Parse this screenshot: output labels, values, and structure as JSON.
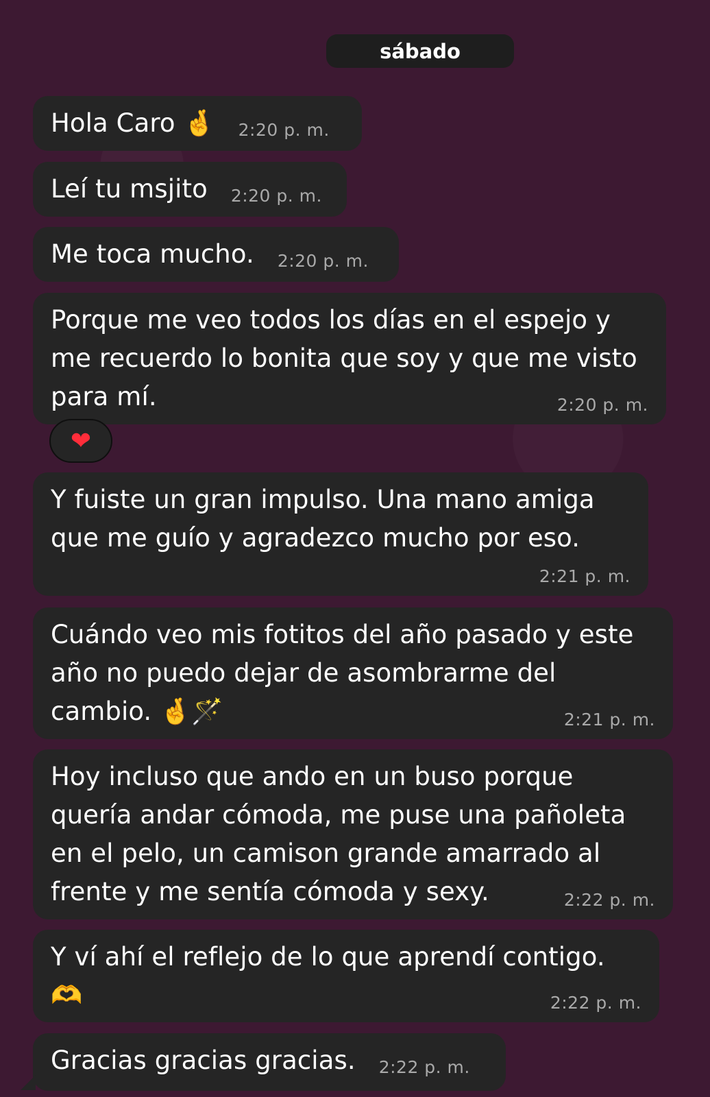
{
  "date_label": "sábado",
  "messages": [
    {
      "text": "Hola Caro 🤞",
      "time": "2:20 p. m."
    },
    {
      "text": "Leí tu msjito",
      "time": "2:20 p. m."
    },
    {
      "text": "Me toca mucho.",
      "time": "2:20 p. m."
    },
    {
      "text": "Porque me veo todos los días en el espejo y me recuerdo lo bonita que soy y que me visto para mí.",
      "time": "2:20 p. m.",
      "reaction": "❤"
    },
    {
      "text": "Y fuiste un gran impulso. Una mano amiga que me guío y agradezco mucho por eso.",
      "time": "2:21 p. m."
    },
    {
      "text": "Cuándo veo mis fotitos del año pasado y este año no puedo dejar de asombrarme del cambio. 🤞🪄",
      "time": "2:21 p. m."
    },
    {
      "text": "Hoy incluso que ando en un buso porque quería andar cómoda, me puse una pañoleta en el pelo, un camison grande amarrado al frente y me sentía cómoda y sexy.",
      "time": "2:22 p. m."
    },
    {
      "text": "Y ví ahí el reflejo de lo que aprendí contigo. 🫶",
      "time": "2:22 p. m."
    },
    {
      "text": "Gracias gracias gracias.",
      "time": "2:22 p. m."
    }
  ]
}
